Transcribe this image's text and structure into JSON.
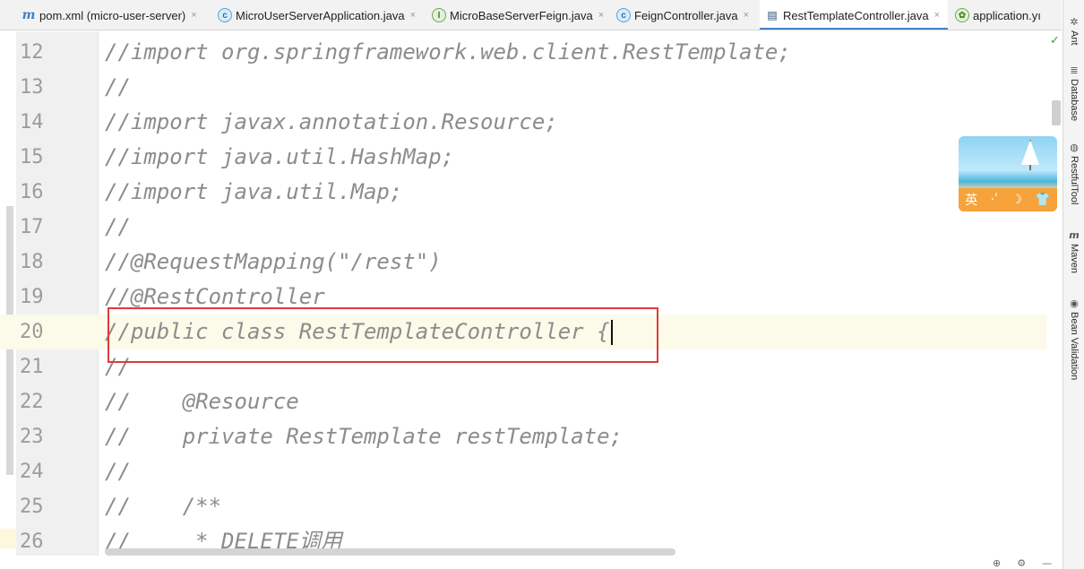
{
  "tabs": [
    {
      "icon": "maven-icon",
      "glyph": "m",
      "label": "pom.xml (micro-user-server)",
      "close": "×",
      "active": false
    },
    {
      "icon": "spring-class-icon",
      "glyph": "c",
      "label": "MicroUserServerApplication.java",
      "close": "×",
      "active": false
    },
    {
      "icon": "interface-icon",
      "glyph": "I",
      "label": "MicroBaseServerFeign.java",
      "close": "×",
      "active": false
    },
    {
      "icon": "class-icon",
      "glyph": "c",
      "label": "FeignController.java",
      "close": "×",
      "active": false
    },
    {
      "icon": "java-file-icon",
      "glyph": "▤",
      "label": "RestTemplateController.java",
      "close": "×",
      "active": true
    },
    {
      "icon": "application-yml-icon",
      "glyph": "✿",
      "label": "application.yı",
      "close": "",
      "active": false
    }
  ],
  "editor": {
    "lines": [
      {
        "num": "12",
        "text": "//import org.springframework.web.client.RestTemplate;"
      },
      {
        "num": "13",
        "text": "//"
      },
      {
        "num": "14",
        "text": "//import javax.annotation.Resource;"
      },
      {
        "num": "15",
        "text": "//import java.util.HashMap;"
      },
      {
        "num": "16",
        "text": "//import java.util.Map;"
      },
      {
        "num": "17",
        "text": "//"
      },
      {
        "num": "18",
        "text": "//@RequestMapping(\"/rest\")"
      },
      {
        "num": "19",
        "text": "//@RestController"
      },
      {
        "num": "20",
        "text": "//public class RestTemplateController {",
        "current": true
      },
      {
        "num": "21",
        "text": "//"
      },
      {
        "num": "22",
        "text": "//    @Resource"
      },
      {
        "num": "23",
        "text": "//    private RestTemplate restTemplate;"
      },
      {
        "num": "24",
        "text": "//"
      },
      {
        "num": "25",
        "text": "//    /**"
      },
      {
        "num": "26",
        "text": "//     * DELETE调用"
      }
    ]
  },
  "right_tools": [
    {
      "icon": "ant-icon",
      "glyph": "✲",
      "label": "Ant"
    },
    {
      "icon": "database-icon",
      "glyph": "≣",
      "label": "Database"
    },
    {
      "icon": "restful-tool-icon",
      "glyph": "◍",
      "label": "RestfulTool"
    },
    {
      "icon": "maven-icon",
      "glyph": "m",
      "label": "Maven"
    },
    {
      "icon": "bean-validation-icon",
      "glyph": "◉",
      "label": "Bean Validation"
    }
  ],
  "ime": {
    "mode": "英",
    "icons": [
      "moon-icon",
      "shirt-icon"
    ],
    "moon": "☽",
    "shirt": "👕",
    "dots": "·ʹ"
  },
  "status_check": "✓",
  "colors": {
    "accent": "#4083c9",
    "highlight_box": "#e03a3a",
    "comment": "#8c8c8c",
    "gutter": "#f0f0f0"
  }
}
